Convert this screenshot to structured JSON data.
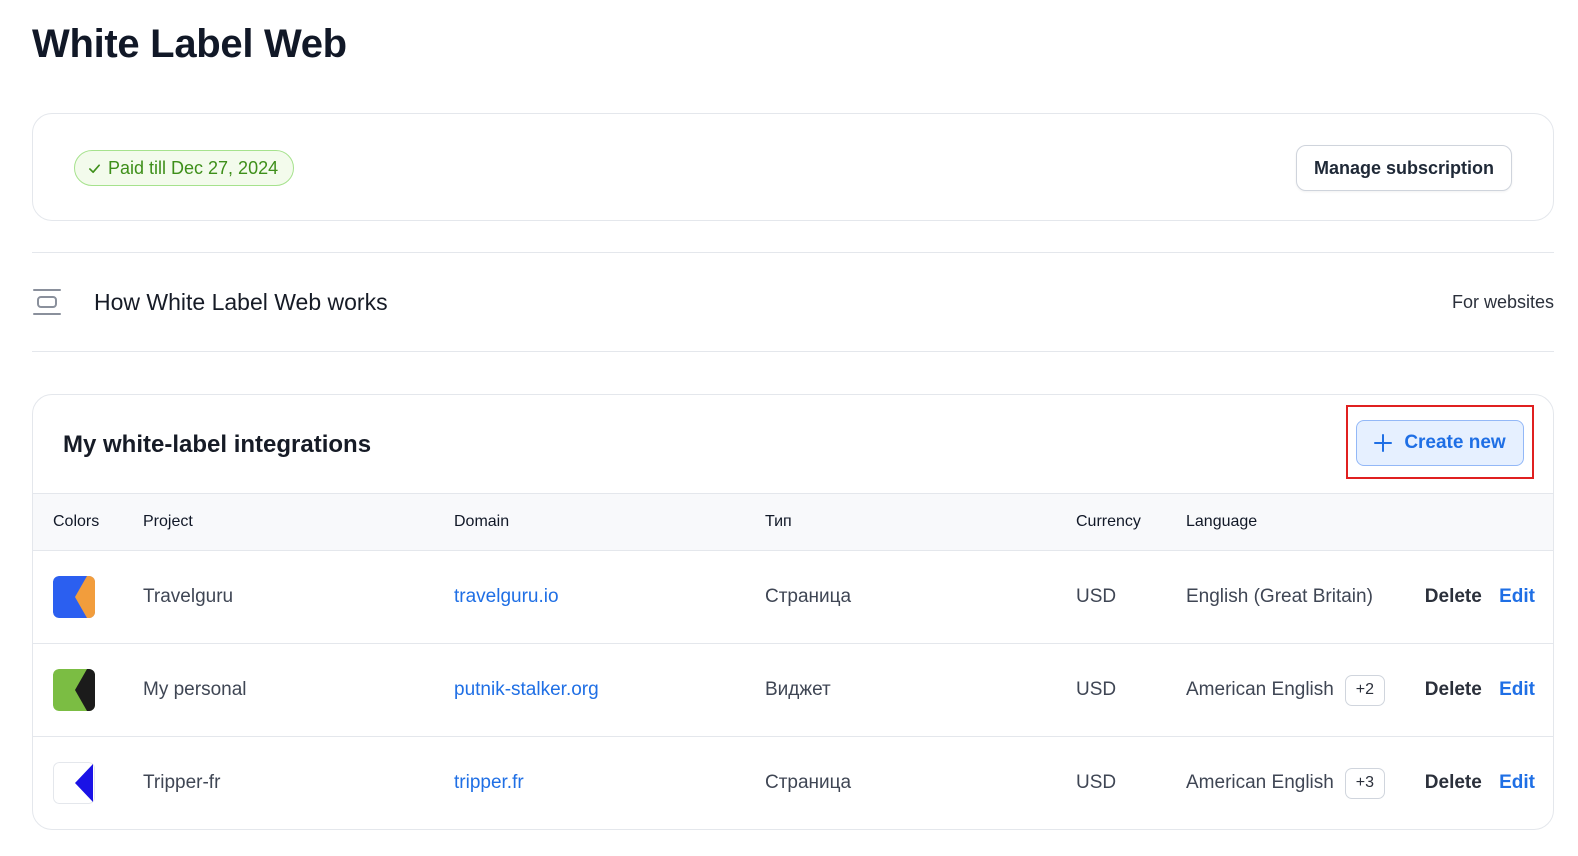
{
  "page": {
    "title": "White Label Web"
  },
  "subscription": {
    "status": "Paid till Dec 27, 2024",
    "status_icon": "check-icon",
    "manage_label": "Manage subscription"
  },
  "how": {
    "icon": "panel-icon",
    "title": "How White Label Web works",
    "tag": "For websites"
  },
  "integrations": {
    "title": "My white-label integrations",
    "create_label": "Create new",
    "create_icon": "plus-icon",
    "columns": {
      "colors": "Colors",
      "project": "Project",
      "domain": "Domain",
      "type": "Тип",
      "currency": "Currency",
      "language": "Language"
    },
    "rows": [
      {
        "colors": {
          "primary": "#2b5ff0",
          "secondary": "#f29d3c"
        },
        "project": "Travelguru",
        "domain": "travelguru.io",
        "type": "Страница",
        "currency": "USD",
        "language": "English (Great Britain)",
        "extra": "",
        "delete_label": "Delete",
        "edit_label": "Edit"
      },
      {
        "colors": {
          "primary": "#7bbd43",
          "secondary": "#1b1b1b"
        },
        "project": "My personal",
        "domain": "putnik-stalker.org",
        "type": "Виджет",
        "currency": "USD",
        "language": "American English",
        "extra": "+2",
        "delete_label": "Delete",
        "edit_label": "Edit"
      },
      {
        "colors": {
          "primary": "#ffffff",
          "secondary": "#1a12e6"
        },
        "project": "Tripper-fr",
        "domain": "tripper.fr",
        "type": "Страница",
        "currency": "USD",
        "language": "American English",
        "extra": "+3",
        "delete_label": "Delete",
        "edit_label": "Edit"
      }
    ]
  },
  "colors": {
    "accent": "#1f6fe5",
    "success": "#3e8f1a",
    "highlight": "#e02020"
  }
}
